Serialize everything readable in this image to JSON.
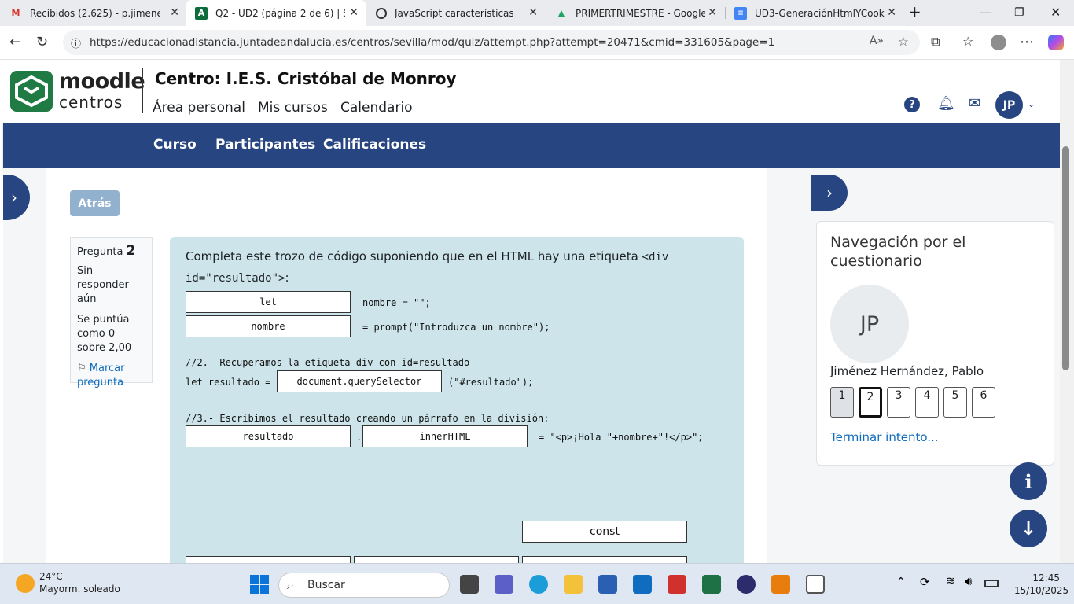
{
  "browser": {
    "tabs": [
      {
        "title": "Recibidos (2.625) - p.jimenez.he",
        "active": false,
        "favicon": "gmail-icon"
      },
      {
        "title": "Q2 - UD2 (página 2 de 6) | Sevil",
        "active": true,
        "favicon": "andalucia-icon"
      },
      {
        "title": "JavaScript características",
        "active": false,
        "favicon": "chatgpt-icon"
      },
      {
        "title": "PRIMERTRIMESTRE - Google Dri",
        "active": false,
        "favicon": "drive-icon"
      },
      {
        "title": "UD3-GeneraciónHtmlYCookies",
        "active": false,
        "favicon": "docs-icon"
      }
    ],
    "url": "https://educacionadistancia.juntadeandalucia.es/centros/sevilla/mod/quiz/attempt.php?attempt=20471&cmid=331605&page=1"
  },
  "moodle": {
    "logo_line1": "moodle",
    "logo_line2": "centros",
    "centro": "Centro:  I.E.S. Cristóbal de Monroy",
    "topnav": [
      "Área personal",
      "Mis cursos",
      "Calendario"
    ],
    "user_initials": "JP",
    "coursenav": [
      "Curso",
      "Participantes",
      "Calificaciones"
    ]
  },
  "quiz": {
    "back_label": "Atrás",
    "question_label": "Pregunta",
    "question_number": "2",
    "status": "Sin responder aún",
    "grade": "Se puntúa como 0 sobre 2,00",
    "flag": "Marcar pregunta",
    "prompt_text": "Completa este trozo de código suponiendo que en el HTML hay una etiqueta ",
    "prompt_code": "<div id=\"resultado\">",
    "prompt_end": ":",
    "drops": {
      "d1": "let",
      "d2": "nombre",
      "d3": "document.querySelector",
      "d4": "resultado",
      "d5": "innerHTML"
    },
    "code": {
      "l1": "nombre = \"\";",
      "l2": "= prompt(\"Introduzca un nombre\");",
      "c2": "//2.- Recuperamos la etiqueta div con id=resultado",
      "l3a": "let resultado =",
      "l3b": "(\"#resultado\");",
      "c3": "//3.- Escribimos el resultado creando un párrafo en la división:",
      "dot": ".",
      "l4": "= \"<p>¡Hola \"+nombre+\"!</p>\";"
    },
    "choice_const": "const"
  },
  "navigation": {
    "title": "Navegación por el cuestionario",
    "initials": "JP",
    "user_name": "Jiménez Hernández, Pablo",
    "questions": [
      "1",
      "2",
      "3",
      "4",
      "5",
      "6"
    ],
    "finish": "Terminar intento..."
  },
  "taskbar": {
    "temp": "24°C",
    "weather": "Mayorm. soleado",
    "search": "Buscar",
    "time": "12:45",
    "date": "15/10/2025"
  }
}
